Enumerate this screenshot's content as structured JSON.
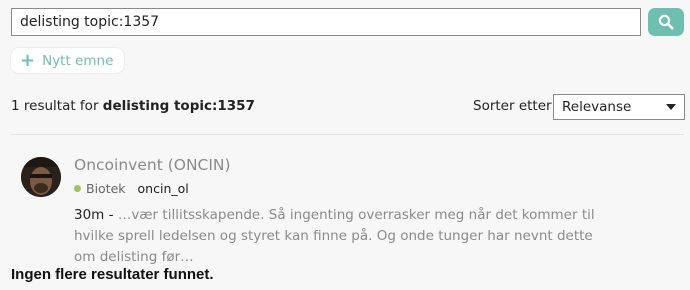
{
  "search": {
    "value": "delisting topic:1357",
    "button_icon": "search-icon"
  },
  "new_topic": {
    "label": "Nytt emne",
    "icon": "plus-icon"
  },
  "results_header": {
    "count_text": "1 resultat for",
    "query": "delisting topic:1357"
  },
  "sort": {
    "label": "Sorter etter",
    "selected": "Relevanse"
  },
  "results": [
    {
      "title": "Oncoinvent (ONCIN)",
      "category": "Biotek",
      "category_color": "#a6c24a",
      "tag": "oncin_ol",
      "date": "30m",
      "separator": " - ",
      "excerpt": "…vær tillitsskapende. Så ingenting overrasker meg når det kommer til hvilke sprell ledelsen og styret kan finne på. Og onde tunger har nevnt dette om delisting før…"
    }
  ],
  "no_more_results": "Ingen flere resultater funnet.",
  "colors": {
    "accent": "#6fbfb1",
    "background": "#f7f7f7"
  }
}
